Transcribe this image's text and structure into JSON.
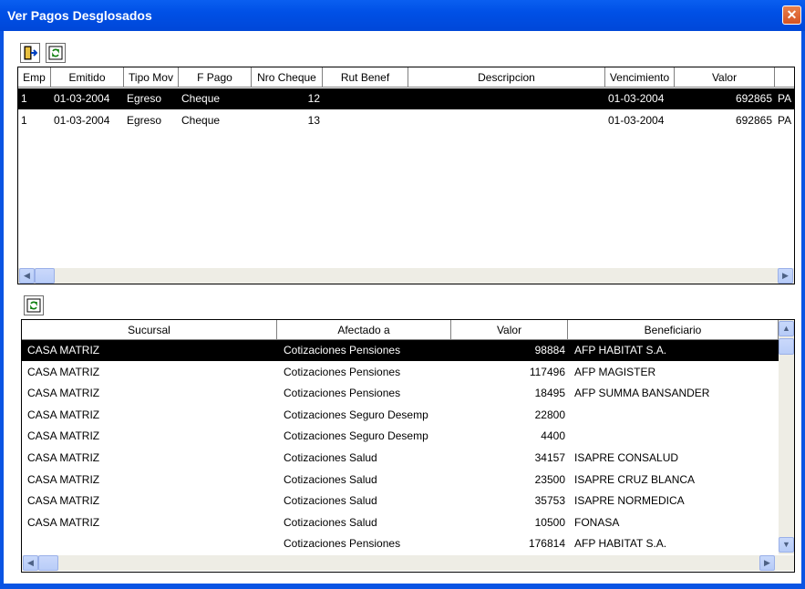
{
  "window": {
    "title": "Ver Pagos Desglosados",
    "close_glyph": "✕"
  },
  "toolbar1": {
    "exit_icon": "exit-door-icon",
    "refresh_icon": "refresh-icon"
  },
  "toolbar2": {
    "refresh_icon": "refresh-icon"
  },
  "top_grid": {
    "columns": [
      "Emp",
      "Emitido",
      "Tipo Mov",
      "F Pago",
      "Nro Cheque",
      "Rut Benef",
      "Descripcion",
      "Vencimiento",
      "Valor"
    ],
    "rows": [
      {
        "emp": "1",
        "emitido": "01-03-2004",
        "tipo_mov": "Egreso",
        "f_pago": "Cheque",
        "nro_cheque": "12",
        "rut_benef": "",
        "descripcion": "",
        "vencimiento": "01-03-2004",
        "valor": "692865",
        "extra": "PA"
      },
      {
        "emp": "1",
        "emitido": "01-03-2004",
        "tipo_mov": "Egreso",
        "f_pago": "Cheque",
        "nro_cheque": "13",
        "rut_benef": "",
        "descripcion": "",
        "vencimiento": "01-03-2004",
        "valor": "692865",
        "extra": "PA"
      }
    ]
  },
  "bottom_grid": {
    "columns": [
      "Sucursal",
      "Afectado a",
      "Valor",
      "Beneficiario"
    ],
    "rows": [
      {
        "sucursal": "CASA MATRIZ",
        "afectado": "Cotizaciones Pensiones",
        "valor": "98884",
        "beneficiario": "AFP HABITAT S.A."
      },
      {
        "sucursal": "CASA MATRIZ",
        "afectado": "Cotizaciones Pensiones",
        "valor": "117496",
        "beneficiario": "AFP MAGISTER"
      },
      {
        "sucursal": "CASA MATRIZ",
        "afectado": "Cotizaciones Pensiones",
        "valor": "18495",
        "beneficiario": "AFP SUMMA BANSANDER"
      },
      {
        "sucursal": "CASA MATRIZ",
        "afectado": "Cotizaciones Seguro Desemp",
        "valor": "22800",
        "beneficiario": ""
      },
      {
        "sucursal": "CASA MATRIZ",
        "afectado": "Cotizaciones Seguro Desemp",
        "valor": "4400",
        "beneficiario": ""
      },
      {
        "sucursal": "CASA MATRIZ",
        "afectado": "Cotizaciones Salud",
        "valor": "34157",
        "beneficiario": "ISAPRE CONSALUD"
      },
      {
        "sucursal": "CASA MATRIZ",
        "afectado": "Cotizaciones Salud",
        "valor": "23500",
        "beneficiario": "ISAPRE CRUZ BLANCA"
      },
      {
        "sucursal": "CASA MATRIZ",
        "afectado": "Cotizaciones Salud",
        "valor": "35753",
        "beneficiario": "ISAPRE NORMEDICA"
      },
      {
        "sucursal": "CASA MATRIZ",
        "afectado": "Cotizaciones Salud",
        "valor": "10500",
        "beneficiario": "FONASA"
      },
      {
        "sucursal": "",
        "afectado": "Cotizaciones Pensiones",
        "valor": "176814",
        "beneficiario": "AFP HABITAT S.A."
      }
    ]
  },
  "colors": {
    "titlebar": "#0a54e3",
    "selection": "#000000",
    "close_button": "#d65323"
  }
}
